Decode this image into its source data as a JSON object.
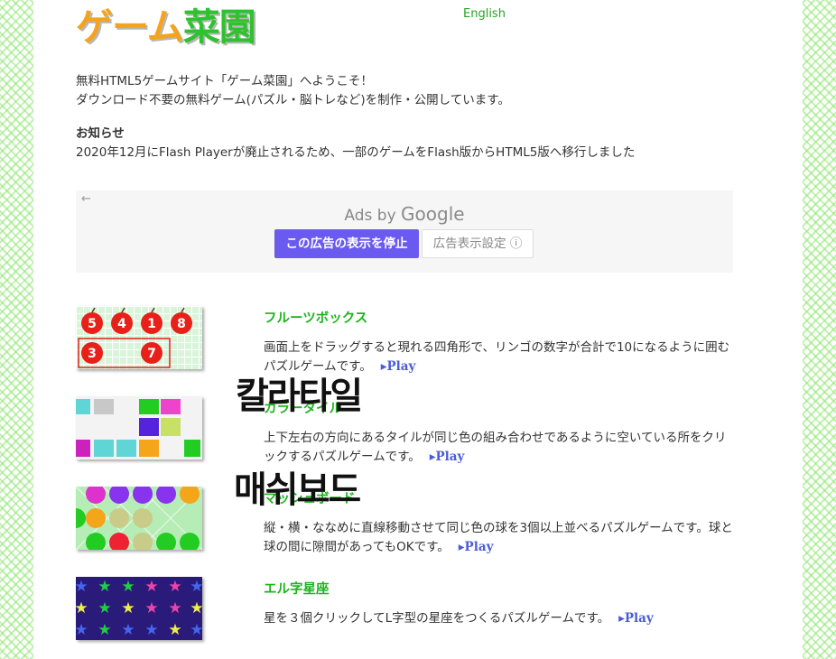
{
  "header": {
    "logo_part1": "ゲーム",
    "logo_part2": "菜園",
    "lang_link": "English"
  },
  "intro": {
    "line1": "無料HTML5ゲームサイト「ゲーム菜園」へようこそ！",
    "line2": "ダウンロード不要の無料ゲーム(パズル・脳トレなど)を制作・公開しています。"
  },
  "notice": {
    "heading": "お知らせ",
    "text": "2020年12月にFlash Playerが廃止されるため、一部のゲームをFlash版からHTML5版へ移行しました"
  },
  "ad": {
    "back": "←",
    "ads_by": "Ads by",
    "google": "Google",
    "stop_label": "この広告の表示を停止",
    "settings_label": "広告表示設定 ⓘ"
  },
  "games": [
    {
      "title": "フルーツボックス",
      "desc": "画面上をドラッグすると現れる四角形で、リンゴの数字が合計で10になるように囲むパズルゲームです。",
      "play": "▸Play",
      "apples": [
        "5",
        "4",
        "1",
        "8",
        "3",
        "7"
      ]
    },
    {
      "title": "カラータイル",
      "desc": "上下左右の方向にあるタイルが同じ色の組み合わせであるように空いている所をクリックするパズルゲームです。",
      "play": "▸Play"
    },
    {
      "title": "マッシュボード",
      "desc": "縦・横・ななめに直線移動させて同じ色の球を3個以上並べるパズルゲームです。球と球の間に隙間があってもOKです。",
      "play": "▸Play"
    },
    {
      "title": "エル字星座",
      "desc": "星を３個クリックしてL字型の星座をつくるパズルゲームです。",
      "play": "▸Play"
    }
  ],
  "overlays": {
    "colortile": "칼라타일",
    "mashboard": "매쉬보드"
  },
  "colors": {
    "green_text": "#1db31d",
    "logo_orange": "#f5a31c",
    "logo_green": "#2fc12f",
    "play_blue": "#4a5cd6",
    "ad_button": "#6a5af0"
  }
}
